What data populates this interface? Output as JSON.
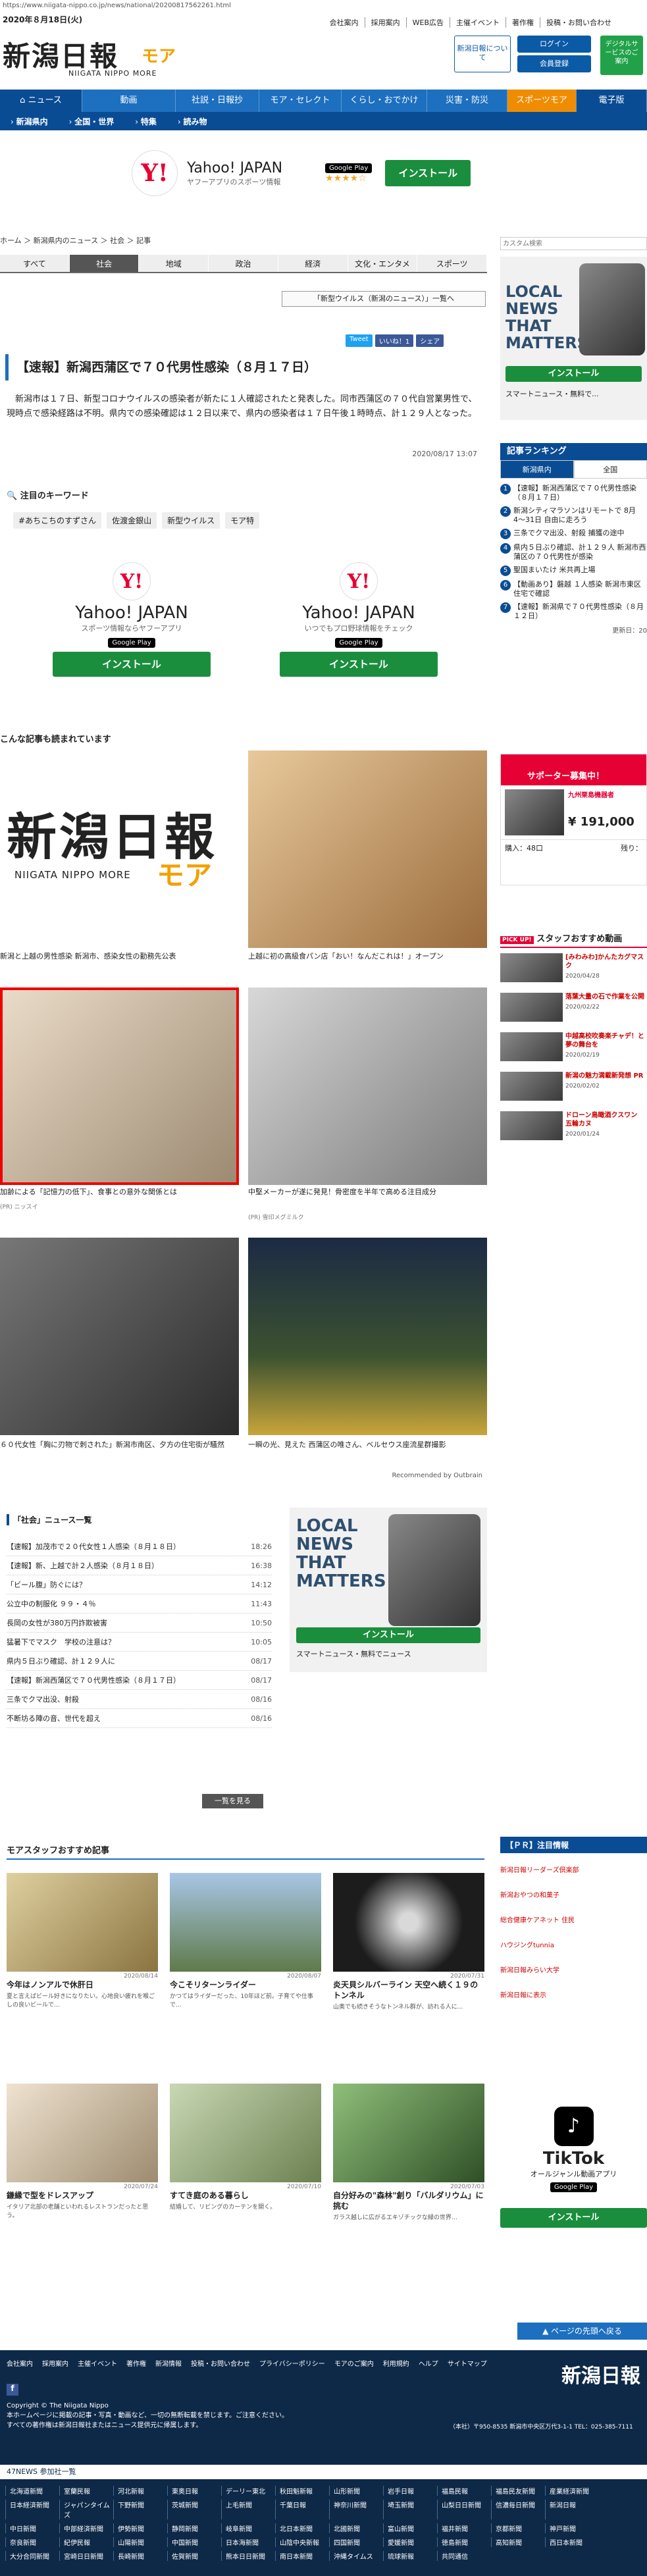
{
  "url": "https://www.niigata-nippo.co.jp/news/national/20200817562261.html",
  "date": "2020年８月18日(火)",
  "top_links": [
    "会社案内",
    "採用案内",
    "WEB広告",
    "主催イベント",
    "著作権",
    "投稿・お問い合わせ"
  ],
  "logo": {
    "main": "新潟日報",
    "sub": "NIIGATA NIPPO MORE",
    "more": "モア"
  },
  "header_buttons": {
    "about": "新潟日報について",
    "login": "ログイン",
    "register": "会員登録",
    "digital": "デジタルサービスのご案内"
  },
  "nav": [
    "ニュース",
    "動画",
    "社説・日報抄",
    "モア・セレクト",
    "くらし・おでかけ",
    "災害・防災",
    "スポーツモア",
    "電子版"
  ],
  "subnav": [
    "新潟県内",
    "全国・世界",
    "特集",
    "読み物"
  ],
  "ad_banner": {
    "brand": "Yahoo! JAPAN",
    "tagline": "ヤフーアプリのスポーツ情報",
    "store": "Google Play",
    "button": "インストール"
  },
  "breadcrumb": "ホーム ＞ 新潟県内のニュース ＞ 社会 ＞ 記事",
  "category_tabs": [
    "すべて",
    "社会",
    "地域",
    "政治",
    "経済",
    "文化・エンタメ",
    "スポーツ"
  ],
  "corona_link": "「新型ウイルス（新潟のニュース）」一覧へ",
  "share": [
    "Tweet",
    "いいね！1",
    "シェア"
  ],
  "article": {
    "title": "【速報】新潟西蒲区で７０代男性感染（８月１７日）",
    "body": "新潟市は１７日、新型コロナウイルスの感染者が新たに１人確認されたと発表した。同市西蒲区の７０代自営業男性で、現時点で感染経路は不明。県内での感染確認は１２日以来で、県内の感染者は１７日午後１時時点、計１２９人となった。",
    "date": "2020/08/17 13:07"
  },
  "keywords": {
    "title": "注目のキーワード",
    "items": [
      "#あちこちのすずさん",
      "佐渡金銀山",
      "新型ウイルス",
      "モア特"
    ]
  },
  "ad_boxes": [
    {
      "brand": "Yahoo! JAPAN",
      "tagline": "スポーツ情報ならヤフーアプリ",
      "store": "Google Play",
      "button": "インストール"
    },
    {
      "brand": "Yahoo! JAPAN",
      "tagline": "いつでもプロ野球情報をチェック",
      "store": "Google Play",
      "button": "インストール"
    }
  ],
  "related_header": "こんな記事も読まれています",
  "related": [
    {
      "caption": "新潟と上越の男性感染 新潟市、感染女性の勤務先公表",
      "source": ""
    },
    {
      "caption": "上越に初の高級食パン店「おい！なんだこれは！」オープン",
      "source": ""
    },
    {
      "caption": "加齢による「記憶力の低下」、食事との意外な関係とは",
      "source": "(PR) ニッスイ"
    },
    {
      "caption": "中堅メーカーが遂に発見！骨密度を半年で高める注目成分",
      "source": "(PR) 雪印メグミルク"
    },
    {
      "caption": "６０代女性「胸に刃物で刺された」新潟市南区、夕方の住宅街が騒然",
      "source": ""
    },
    {
      "caption": "一瞬の光、見えた 西蒲区の唯さん、ベルセウス座流星群撮影",
      "source": ""
    }
  ],
  "recommended_by": "Recommended by Outbrain",
  "social_news": {
    "title": "「社会」ニュース一覧",
    "rows": [
      {
        "t": "【速報】加茂市で２０代女性１人感染（８月１８日）",
        "d": "18:26"
      },
      {
        "t": "【速報】新、上越で計２人感染（８月１８日）",
        "d": "16:38"
      },
      {
        "t": "「ビール腹」防ぐには？",
        "d": "14:12"
      },
      {
        "t": "公立中の制服化 ９９・４％",
        "d": "11:43"
      },
      {
        "t": "長岡の女性が380万円詐欺被害",
        "d": "10:50"
      },
      {
        "t": "猛暑下でマスク　学校の注意は？",
        "d": "10:05"
      },
      {
        "t": "県内５日ぶり確認、計１２９人に",
        "d": "08/17"
      },
      {
        "t": "【速報】新潟西蒲区で７０代男性感染（８月１７日）",
        "d": "08/17"
      },
      {
        "t": "三条でクマ出没、射殺",
        "d": "08/16"
      },
      {
        "t": "不断坊る陣の音、世代を超え",
        "d": "08/16"
      }
    ],
    "more": "一覧を見る"
  },
  "local_news_ad": {
    "title": "LOCAL NEWS THAT MATTERS",
    "app": "スマートニュース・無料でニュース",
    "button": "インストール"
  },
  "moa_header": "モアスタッフおすすめ記事",
  "moa_cards": [
    {
      "date": "2020/08/14",
      "title": "今年はノンアルで休肝日",
      "excerpt": "夏と言えばビール好きになりたい。心地良い疲れを喉ごしの良いビールで..."
    },
    {
      "date": "2020/08/07",
      "title": "今こそリターンライダー",
      "excerpt": "かつてはライダーだった、10年ほど前。子育てや仕事で..."
    },
    {
      "date": "2020/07/31",
      "title": "炎天貝シルバーライン 天空へ続く１９のトンネル",
      "excerpt": "山奥でも続きそうなトンネル群が、訪れる人に..."
    },
    {
      "date": "2020/07/24",
      "title": "鎌縁で型をドレスアップ",
      "excerpt": "イタリア北部の老舗といわれるレストランだったと思う。"
    },
    {
      "date": "2020/07/10",
      "title": "すてき庭のある暮らし",
      "excerpt": "結婚して、リビングのカーテンを開く。"
    },
    {
      "date": "2020/07/03",
      "title": "自分好みの\"森林\"創り「バルダリウム」に挑む",
      "excerpt": "ガラス越しに広がるエキゾチックな緑の世界…"
    }
  ],
  "right": {
    "search_placeholder": "カスタム検索",
    "local_ad": {
      "title": "LOCAL NEWS THAT MATTERS",
      "app": "スマートニュース・無料で...",
      "button": "インストール"
    },
    "ranking": {
      "title": "記事ランキング",
      "tabs": [
        "新潟県内",
        "全国"
      ],
      "items": [
        "【速報】新潟西蒲区で７０代男性感染（８月１７日）",
        "新潟シティマラソンはリモートで 8月4〜31日 自由に走ろう",
        "三条でクマ出没、射殺 捕獲の途中",
        "県内５日ぶり確認、計１２９人 新潟市西蒲区の７０代男性が感染",
        "聖国まいたけ 米共再上場",
        "【動画あり】磐越 １人感染 新潟市東区住宅で確認",
        "【速報】新潟県で７０代男性感染（８月１２日）"
      ],
      "updated": "更新日：20"
    },
    "supporter": {
      "title": "サポーター募集中！",
      "ship": "九州栗島機器者",
      "price": "¥ 191,000",
      "buy": "購入：48口",
      "rest": "残り："
    },
    "staff_pick": {
      "title": "スタッフおすすめ動画",
      "items": [
        {
          "t": "[みわみわ]かんたカグマスク",
          "d": "2020/04/28"
        },
        {
          "t": "落葉大量の石で作業を公開",
          "d": "2020/02/22"
        },
        {
          "t": "中越高校吹奏楽チャデ！と夢の舞台を",
          "d": "2020/02/19"
        },
        {
          "t": "新潟の魅力満載新発想 PR",
          "d": "2020/02/02"
        },
        {
          "t": "ドローン鳥瞰酒クスワン 五輪カヌ",
          "d": "2020/01/24"
        }
      ]
    },
    "pr_info": {
      "title": "【ＰＲ】注目情報",
      "items": [
        "新潟日報リーダーズ倶楽部",
        "新潟おやつの和菓子",
        "総合健康ケアネット 住民",
        "ハウジングtunnia",
        "新潟日報みらい大学",
        "新潟日報に表示"
      ]
    },
    "tiktok": {
      "title": "TikTok",
      "desc": "オールジャンル動画アプリ",
      "store": "Google Play",
      "button": "インストール"
    }
  },
  "page_top": "ページの先頭へ戻る",
  "footer": {
    "links": [
      "会社案内",
      "採用案内",
      "主催イベント",
      "著作権",
      "新潟情報",
      "投稿・お問い合わせ",
      "プライバシーポリシー",
      "モアのご案内",
      "利用規約",
      "ヘルプ",
      "サイトマップ"
    ],
    "copyright": "Copyright © The Niigata Nippo",
    "note1": "本ホームページに掲載の記事・写真・動画など、一切の無断転載を禁じます。ご注意ください。",
    "note2": "すべての著作権は新潟日報社またはニュース提供元に帰属します。",
    "logo": "新潟日報",
    "address": "（本社）〒950-8535 新潟市中央区万代3-1-1 TEL：025-385-7111",
    "site47": "47NEWS 参加社一覧",
    "newspapers": [
      "北海道新聞",
      "室蘭民報",
      "河北新報",
      "東奥日報",
      "デーリー東北",
      "秋田魁新報",
      "山形新聞",
      "岩手日報",
      "福島民報",
      "福島民友新聞",
      "産業経済新聞",
      "日本経済新聞",
      "ジャパンタイムズ",
      "下野新聞",
      "茨城新聞",
      "上毛新聞",
      "千葉日報",
      "神奈川新聞",
      "埼玉新聞",
      "山梨日日新聞",
      "信濃毎日新聞",
      "新潟日報",
      "中日新聞",
      "中部経済新聞",
      "伊勢新聞",
      "静岡新聞",
      "岐阜新聞",
      "北日本新聞",
      "北國新聞",
      "富山新聞",
      "福井新聞",
      "京都新聞",
      "神戸新聞",
      "奈良新聞",
      "紀伊民報",
      "山陽新聞",
      "中国新聞",
      "日本海新聞",
      "山陰中央新報",
      "四国新聞",
      "愛媛新聞",
      "徳島新聞",
      "高知新聞",
      "西日本新聞",
      "大分合同新聞",
      "宮崎日日新聞",
      "長崎新聞",
      "佐賀新聞",
      "熊本日日新聞",
      "南日本新聞",
      "沖縄タイムス",
      "琉球新報",
      "共同通信"
    ]
  }
}
